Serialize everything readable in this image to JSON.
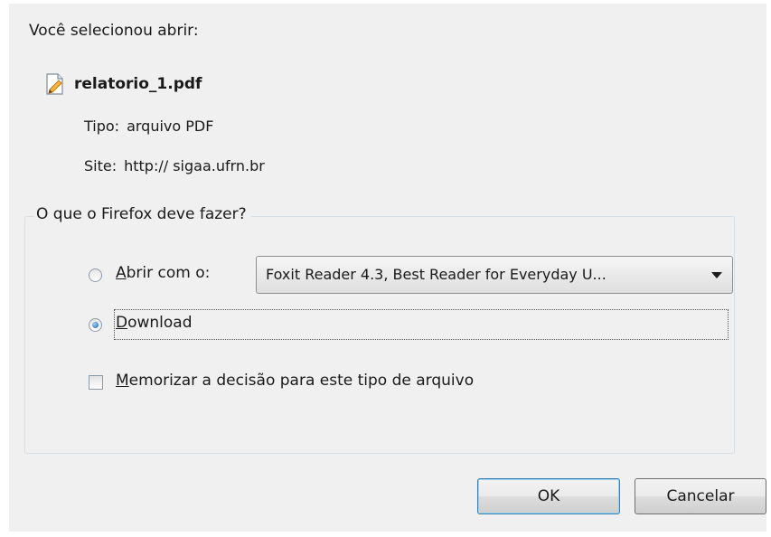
{
  "dialog": {
    "intro": "Você selecionou abrir:",
    "file": {
      "icon": "pdf-file-icon",
      "name": "relatorio_1.pdf"
    },
    "type": {
      "label": "Tipo:",
      "value": "arquivo PDF"
    },
    "site": {
      "label": "Site:",
      "value": "http:// sigaa.ufrn.br"
    }
  },
  "action_group": {
    "legend": "O que o Firefox deve fazer?",
    "open_with": {
      "label_underlined": "A",
      "label_rest": "brir com o:",
      "selected": false
    },
    "app_select": {
      "value": "Foxit Reader 4.3, Best Reader for Everyday U..."
    },
    "download": {
      "label_underlined": "D",
      "label_rest": "ownload",
      "selected": true
    },
    "remember": {
      "label_underlined": "M",
      "label_rest": "emorizar a decisão para este tipo de arquivo",
      "checked": false
    }
  },
  "buttons": {
    "ok": "OK",
    "cancel": "Cancelar"
  }
}
